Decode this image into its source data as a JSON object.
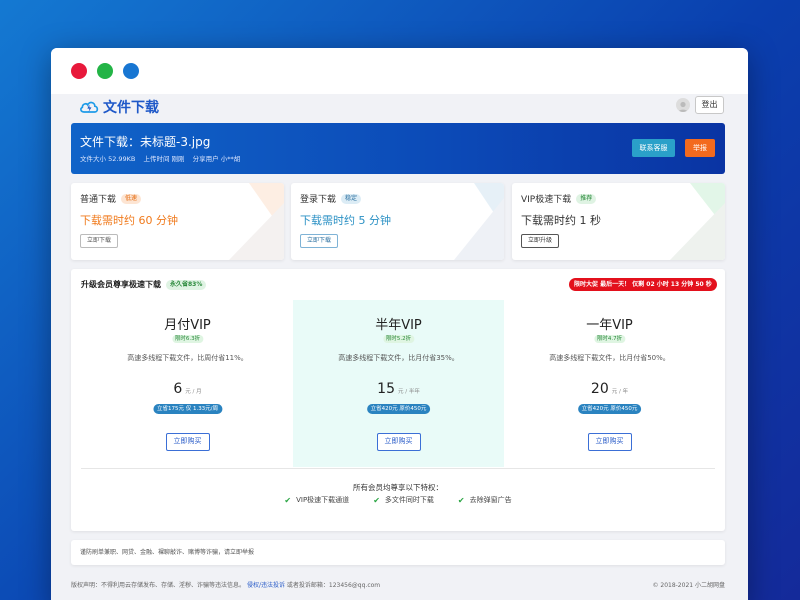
{
  "window": {
    "controls": [
      "red",
      "green",
      "blue"
    ]
  },
  "header": {
    "logo_text": "文件下载",
    "logout_label": "登出"
  },
  "banner": {
    "file_title": "文件下载：未标题-3.jpg",
    "size": "文件大小 52.99KB",
    "upload_time": "上传时间 刚刚",
    "sharer": "分享用户 小**胡",
    "service_label": "联系客服",
    "report_label": "举报"
  },
  "cards": [
    {
      "title": "普通下载",
      "badge": "低速",
      "time": "下载需时约 60 分钟",
      "button": "立即下载",
      "color": "#f07a1c",
      "badge_bg": "#fde5d3",
      "badge_color": "#e46a0e"
    },
    {
      "title": "登录下载",
      "badge": "稳定",
      "time": "下载需时约 5 分钟",
      "button": "立即下载",
      "color": "#2a90c4",
      "badge_bg": "#dcecf5",
      "badge_color": "#2a6fa0"
    },
    {
      "title": "VIP极速下载",
      "badge": "推荐",
      "time": "下载需时约 1 秒",
      "button": "立即升级",
      "color": "#333333",
      "badge_bg": "#dff3e3",
      "badge_color": "#2b8a3c"
    }
  ],
  "vip": {
    "title": "升级会员尊享极速下载",
    "title_badge": "永久省83%",
    "promo": "限时大促 最后一天！ 仅剩 02 小时 13 分钟 50 秒",
    "plans": [
      {
        "name": "月付VIP",
        "discount": "限时6.3折",
        "desc": "高速多线程下载文件，比周付省11%。",
        "price": "6",
        "unit": "元 / 月",
        "pill": "立省175元 仅 1.33元/周",
        "button": "立即购买"
      },
      {
        "name": "半年VIP",
        "discount": "限时5.2折",
        "desc": "高速多线程下载文件，比月付省35%。",
        "price": "15",
        "unit": "元 / 半年",
        "pill": "立省420元 原价450元",
        "button": "立即购买"
      },
      {
        "name": "一年VIP",
        "discount": "限时4.7折",
        "desc": "高速多线程下载文件，比月付省50%。",
        "price": "20",
        "unit": "元 / 年",
        "pill": "立省420元 原价450元",
        "button": "立即购买"
      }
    ],
    "privileges_title": "所有会员均尊享以下特权：",
    "privileges": [
      "VIP极速下载通道",
      "多文件同时下载",
      "去除弹窗广告"
    ]
  },
  "notice": "谨防刷单兼职、网贷、金融、裸聊敲诈、赌博等诈骗，请立即举报",
  "footer": {
    "copyright_prefix": "版权声明：不得利用云存储发布、存储、淫秽、诈骗等违法信息。",
    "complaint_link": "侵权/违法投诉",
    "email": "或者投诉邮箱：123456@qq.com",
    "copyright": "© 2018-2021 小二胡网盘"
  }
}
